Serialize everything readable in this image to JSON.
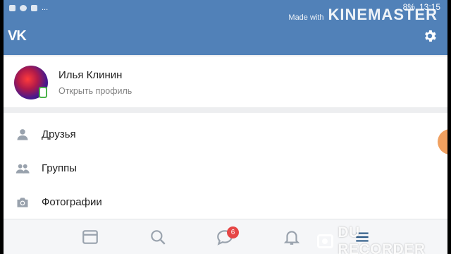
{
  "status_bar": {
    "dots": "...",
    "battery": "8%",
    "time": "13:15"
  },
  "watermark_top": {
    "prefix": "Made with",
    "brand": "KINEMASTER"
  },
  "app": {
    "logo": "VK",
    "settings_icon": "gear-icon"
  },
  "profile": {
    "name": "Илья Клинин",
    "subtitle": "Открыть профиль"
  },
  "menu": {
    "items": [
      {
        "label": "Друзья",
        "icon": "person-icon"
      },
      {
        "label": "Группы",
        "icon": "people-icon"
      },
      {
        "label": "Фотографии",
        "icon": "camera-icon"
      }
    ]
  },
  "bottom_nav": {
    "messages_badge": "6",
    "items": [
      "newsfeed-icon",
      "search-icon",
      "messages-icon",
      "bell-icon",
      "menu-icon"
    ]
  },
  "watermark_bottom": {
    "text": "DU RECORDER"
  },
  "colors": {
    "brand": "#5181b8",
    "badge": "#e64646",
    "online": "#4bb34b"
  }
}
